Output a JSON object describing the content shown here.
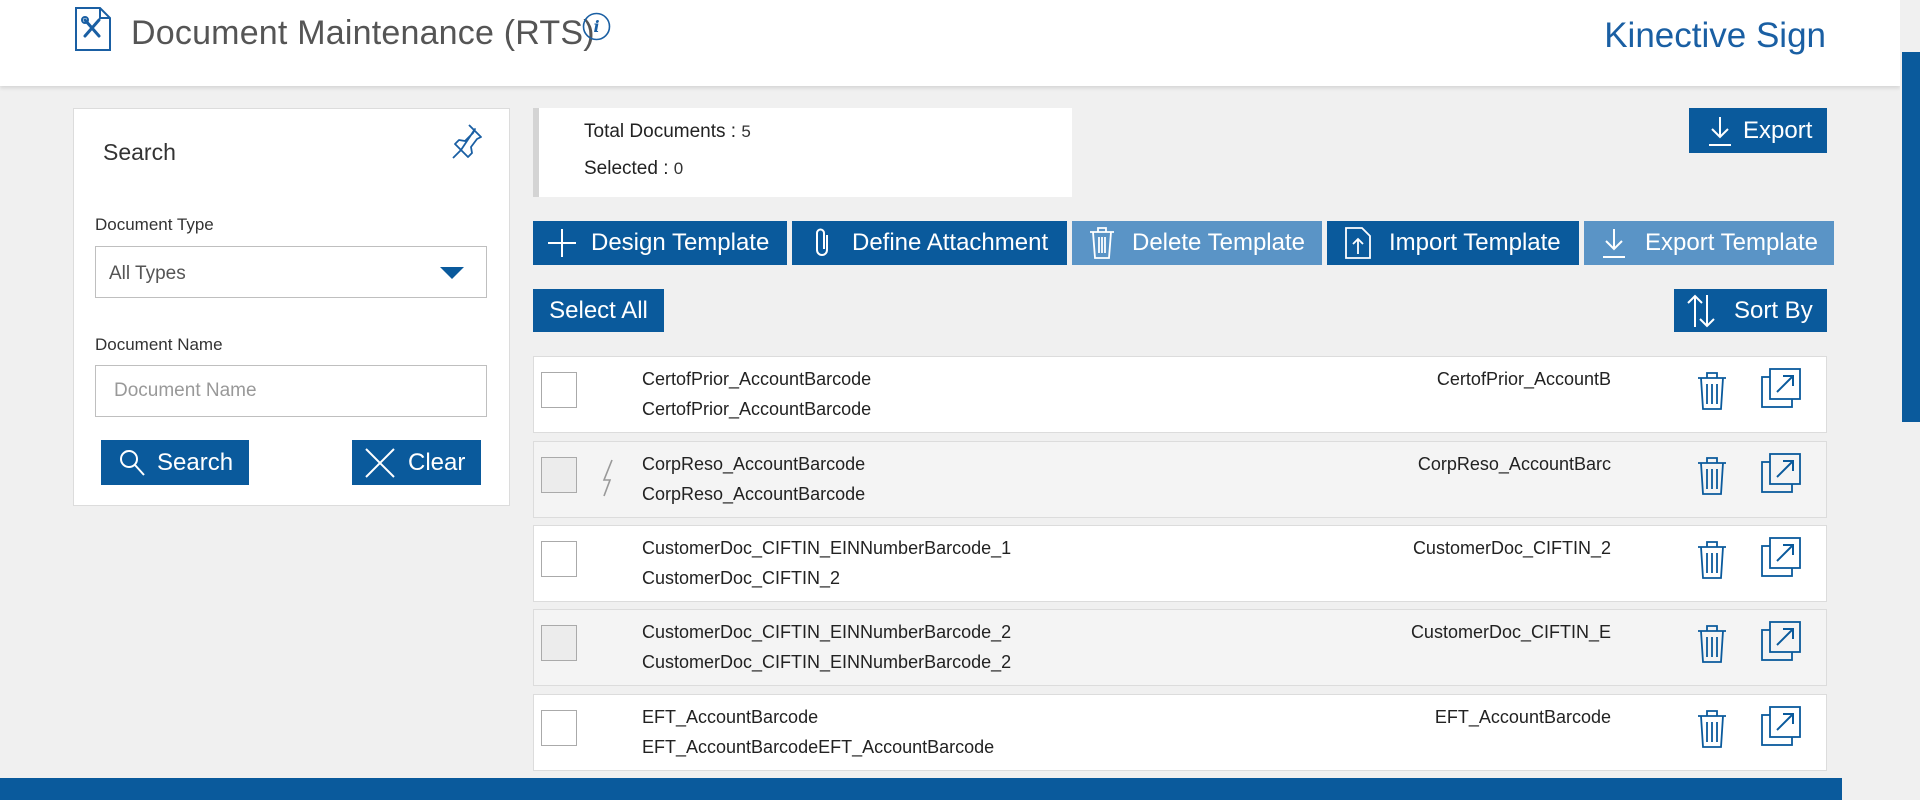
{
  "header": {
    "title": "Document Maintenance (RTS)",
    "brand": "Kinective Sign"
  },
  "search": {
    "title": "Search",
    "document_type_label": "Document Type",
    "document_type_value": "All Types",
    "document_name_label": "Document Name",
    "document_name_placeholder": "Document Name",
    "search_label": "Search",
    "clear_label": "Clear"
  },
  "counts": {
    "total_label": "Total Documents : ",
    "total_value": "5",
    "selected_label": "Selected : ",
    "selected_value": "0"
  },
  "toolbar": {
    "export_label": "Export",
    "design_template_label": "Design Template",
    "define_attachment_label": "Define Attachment",
    "delete_template_label": "Delete Template",
    "import_template_label": "Import Template",
    "export_template_label": "Export Template",
    "select_all_label": "Select All",
    "sort_by_label": "Sort By"
  },
  "documents": [
    {
      "name": "CertofPrior_AccountBarcode",
      "description": "CertofPrior_AccountBarcode",
      "code": "CertofPrior_AccountB",
      "has_lightning": false
    },
    {
      "name": "CorpReso_AccountBarcode",
      "description": "CorpReso_AccountBarcode",
      "code": "CorpReso_AccountBarc",
      "has_lightning": true
    },
    {
      "name": "CustomerDoc_CIFTIN_EINNumberBarcode_1",
      "description": "CustomerDoc_CIFTIN_2",
      "code": "CustomerDoc_CIFTIN_2",
      "has_lightning": false
    },
    {
      "name": "CustomerDoc_CIFTIN_EINNumberBarcode_2",
      "description": "CustomerDoc_CIFTIN_EINNumberBarcode_2",
      "code": "CustomerDoc_CIFTIN_E",
      "has_lightning": false
    },
    {
      "name": "EFT_AccountBarcode",
      "description": "EFT_AccountBarcodeEFT_AccountBarcode",
      "code": "EFT_AccountBarcode",
      "has_lightning": false
    }
  ],
  "colors": {
    "primary": "#0a5a9c",
    "primary_light": "#5a94c6",
    "brand_text": "#1a5fa3"
  },
  "icons": [
    "document-tools-icon",
    "info-icon",
    "pin-icon",
    "search-icon",
    "close-icon",
    "download-icon",
    "plus-icon",
    "paperclip-icon",
    "trash-icon",
    "upload-icon",
    "sort-icon",
    "lightning-icon",
    "popout-icon"
  ]
}
